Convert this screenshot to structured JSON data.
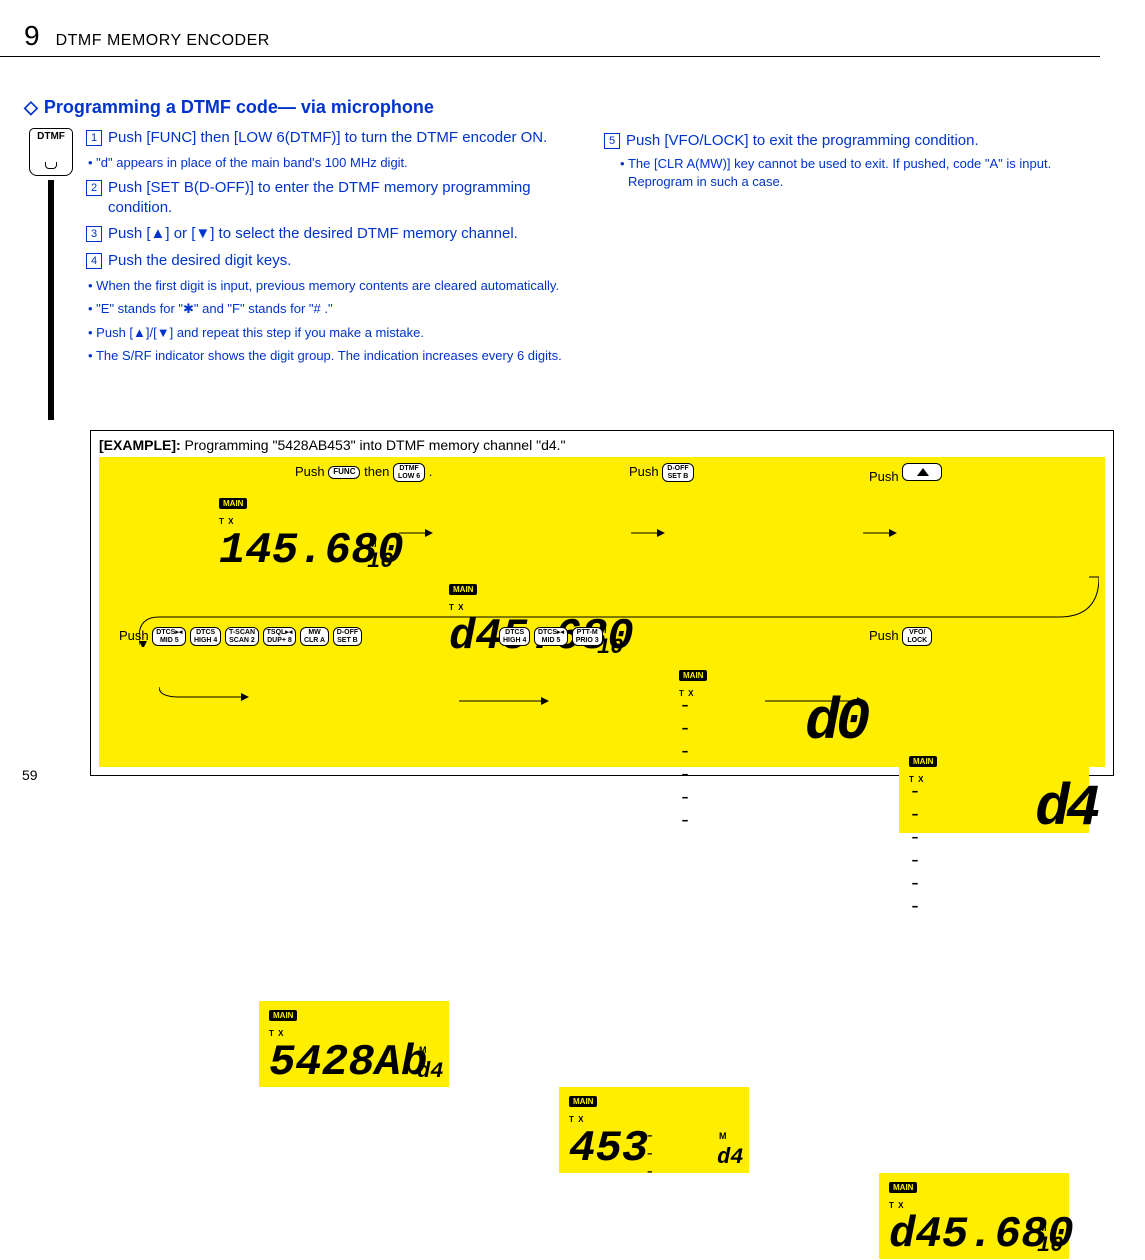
{
  "header": {
    "chapter_num": "9",
    "chapter_title": "DTMF MEMORY ENCODER"
  },
  "section": {
    "arrow": "◇",
    "title": "Programming a DTMF code— via microphone"
  },
  "icon_label": "DTMF",
  "steps": {
    "s1": {
      "num": "1",
      "text_a": "Push [FUNC] then [",
      "text_b": "LOW",
      "text_c": " 6(DTMF)] to turn the DTMF encoder ON."
    },
    "s1_sub": "\"d\" appears in place of the main band's 100 MHz digit.",
    "s2": {
      "num": "2",
      "text_a": "Push [",
      "text_b": "SET",
      "text_c": " B(D-OFF)] to enter the DTMF memory programming condition."
    },
    "s3": {
      "num": "3",
      "text": "Push [▲] or [▼] to select the desired DTMF memory channel."
    },
    "s4": {
      "num": "4",
      "text": "Push the desired digit keys."
    },
    "s4_subs": [
      "When the first digit is input, previous memory contents are cleared automatically.",
      "\"E\" stands for \"✱\" and \"F\" stands for \"# .\"",
      "Push [▲]/[▼] and repeat this step if you make a mistake.",
      "The S/RF indicator shows the digit group. The indication increases every 6 digits."
    ],
    "s5": {
      "num": "5",
      "text": "Push [VFO/LOCK] to exit the programming condition."
    },
    "s5_sub_a": "The [",
    "s5_sub_b": "CLR",
    "s5_sub_c": " A(MW)] key cannot be used to exit. If pushed, code \"A\" is input. Reprogram in such a case."
  },
  "example": {
    "label": "[EXAMPLE]:",
    "text": " Programming \"5428AB453\" into DTMF memory channel \"d4.\"",
    "push": "Push",
    "then": " then ",
    "dot": " .",
    "btn_func": "FUNC",
    "btn_dtmf6": {
      "top": "DTMF",
      "bot": "LOW 6"
    },
    "btn_setb": {
      "top": "D-OFF",
      "bot": "SET B"
    },
    "btn_vfo": {
      "top": "VFO/",
      "bot": "LOCK"
    },
    "seq_btns": [
      {
        "top": "DTCS▸◂",
        "bot": "MID 5"
      },
      {
        "top": "DTCS",
        "bot": "HIGH 4"
      },
      {
        "top": "T-SCAN",
        "bot": "SCAN 2"
      },
      {
        "top": "TSQL▸◂",
        "bot": "DUP+ 8"
      },
      {
        "top": "MW",
        "bot": "CLR A"
      },
      {
        "top": "D-OFF",
        "bot": "SET B"
      }
    ],
    "seq_btns2": [
      {
        "top": "DTCS",
        "bot": "HIGH 4"
      },
      {
        "top": "DTCS▸◂",
        "bot": "MID 5"
      },
      {
        "top": "PTT-M",
        "bot": "PRIO 3"
      }
    ],
    "disp": {
      "main": "MAIN",
      "tx": "T X",
      "m": "M",
      "d1_freq": "145.680",
      "d1_ch": "10",
      "d2_freq": "d45.680",
      "d2_ch": "10",
      "d3_sub": "d0",
      "d4_sub": "d4",
      "d5_main": "5428Ab",
      "d5_sub": "d4",
      "d6_main": "453",
      "d6_sub": "d4",
      "d7_freq": "d45.680",
      "d7_ch": "10"
    }
  },
  "page_num": "59"
}
